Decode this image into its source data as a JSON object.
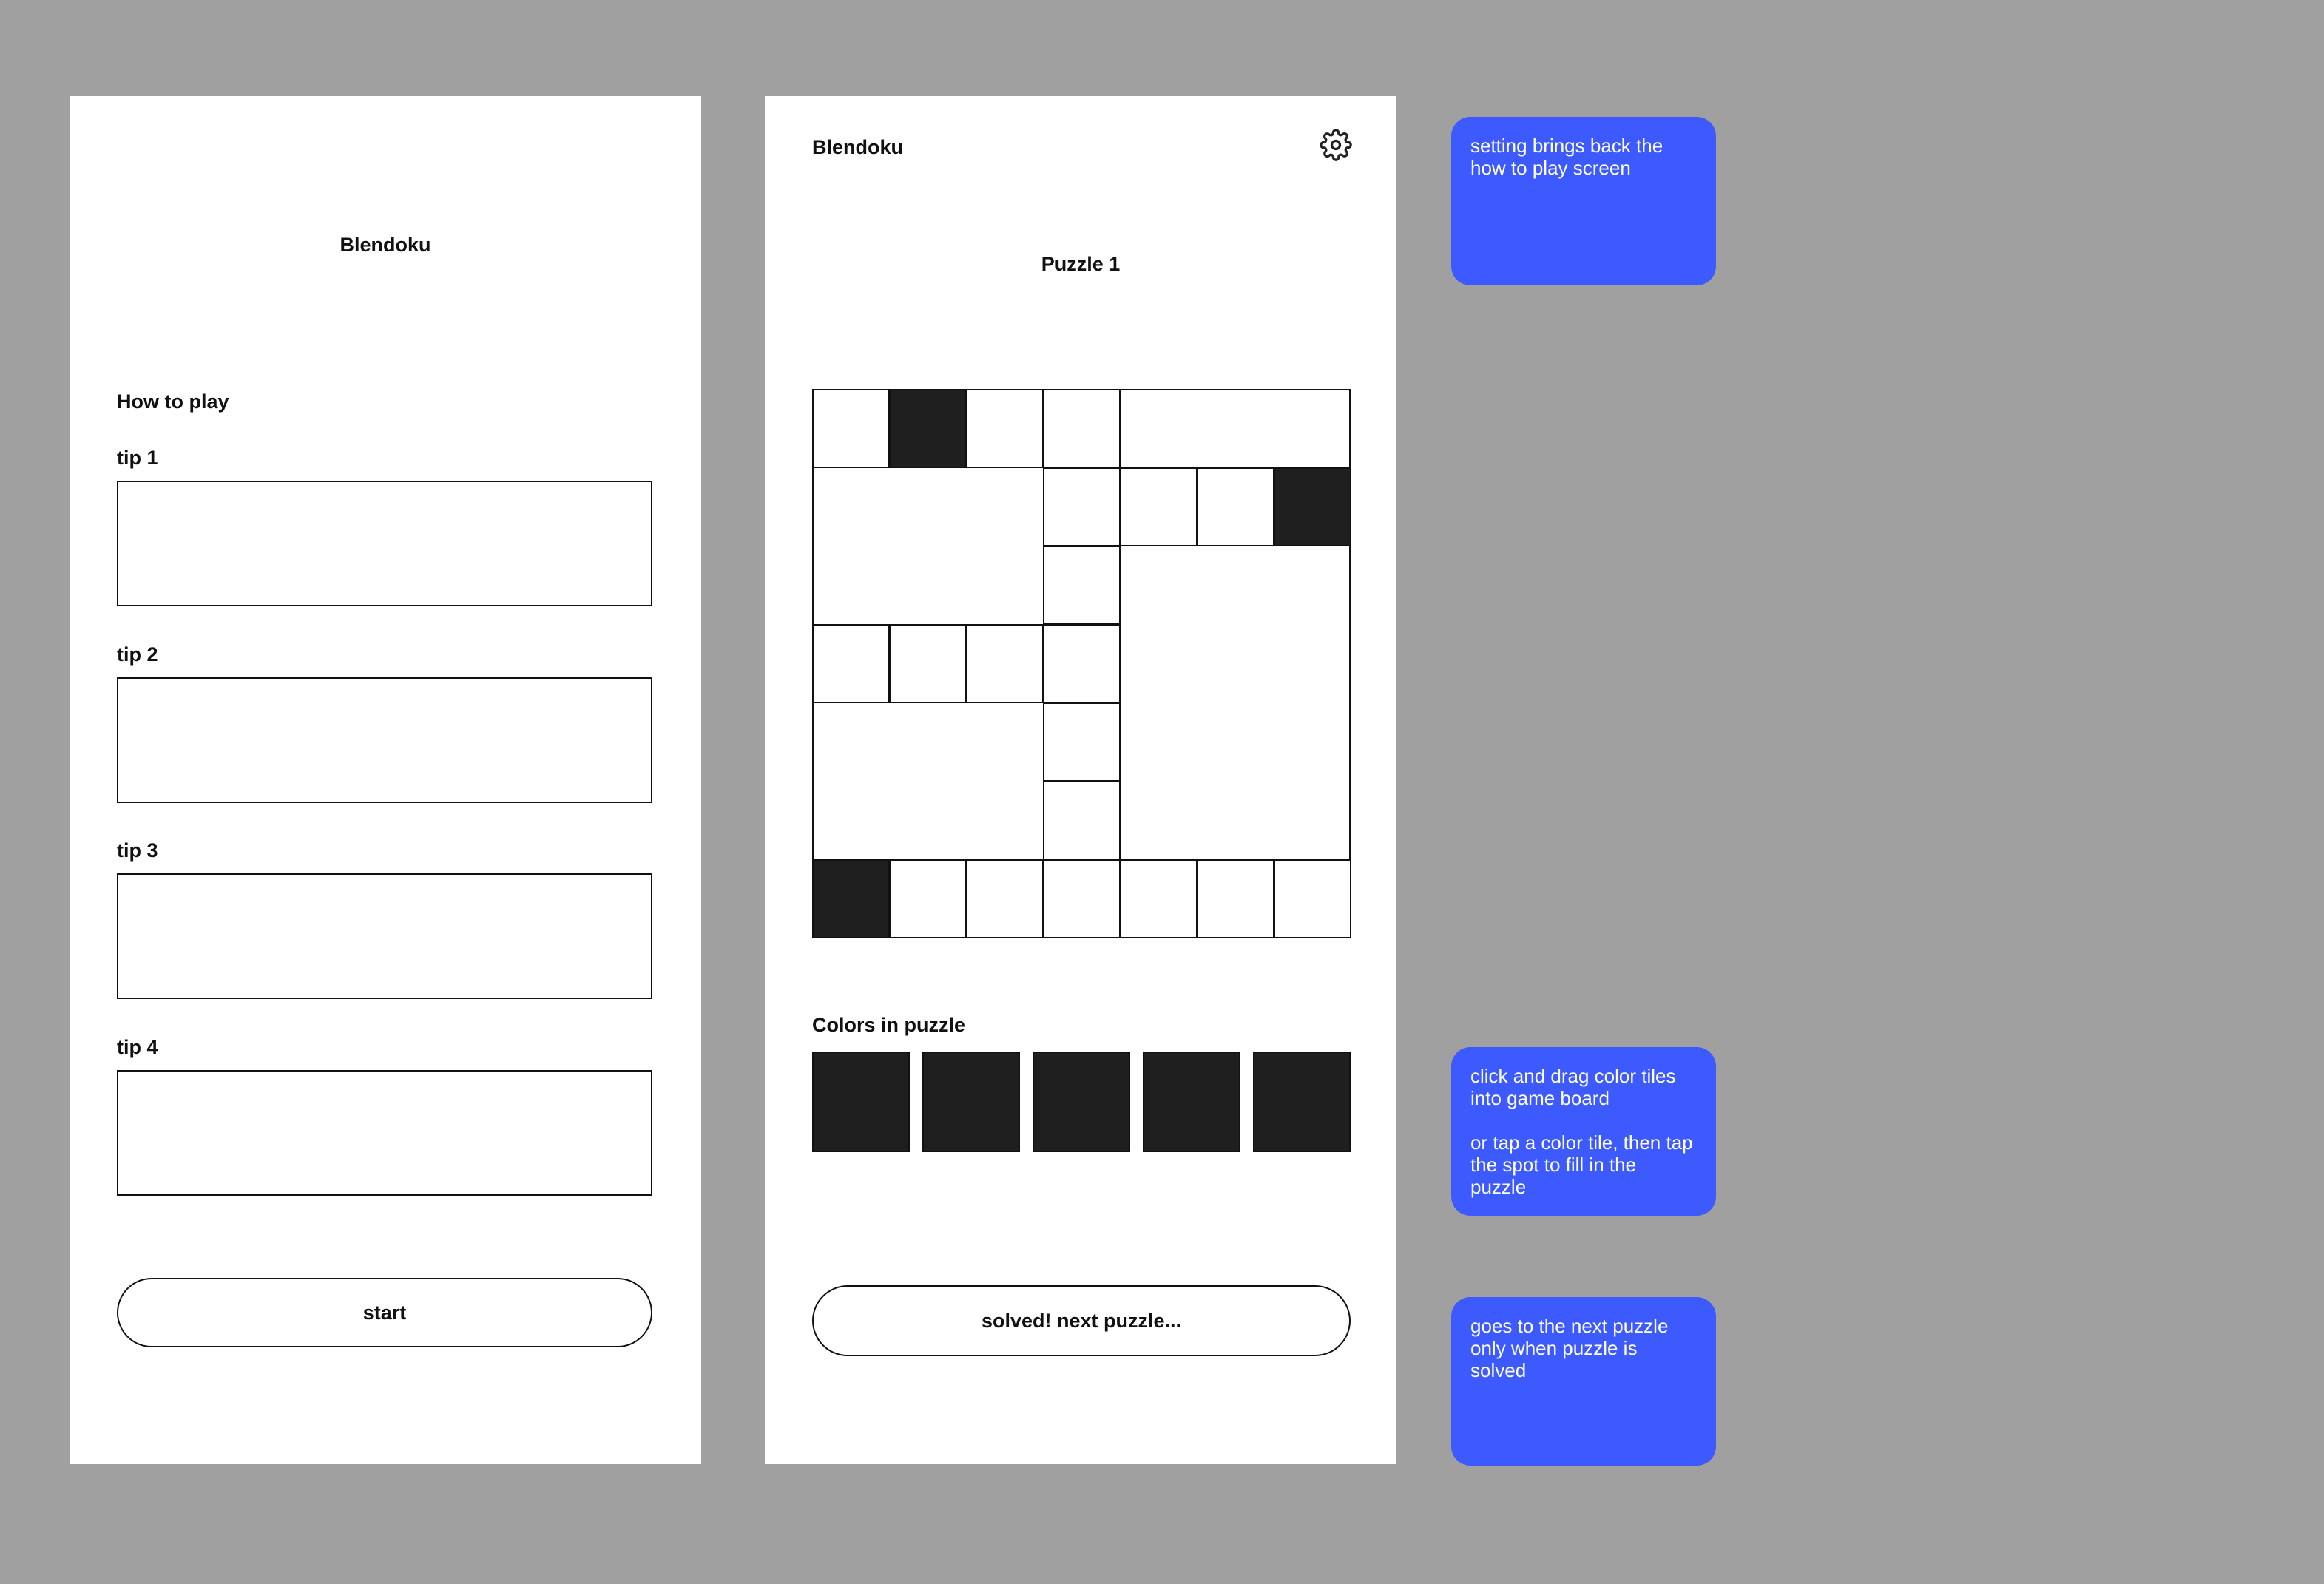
{
  "howto_screen": {
    "app_title": "Blendoku",
    "heading": "How to play",
    "tips": [
      {
        "label": "tip 1"
      },
      {
        "label": "tip 2"
      },
      {
        "label": "tip 3"
      },
      {
        "label": "tip 4"
      }
    ],
    "start_label": "start"
  },
  "puzzle_screen": {
    "app_title": "Blendoku",
    "settings_icon": "gear-icon",
    "puzzle_title": "Puzzle 1",
    "board": {
      "grid_cols": 7,
      "grid_rows": 7,
      "cells": [
        {
          "col": 0,
          "row": 0,
          "filled": false
        },
        {
          "col": 1,
          "row": 0,
          "filled": true
        },
        {
          "col": 2,
          "row": 0,
          "filled": false
        },
        {
          "col": 3,
          "row": 0,
          "filled": false
        },
        {
          "col": 3,
          "row": 1,
          "filled": false
        },
        {
          "col": 4,
          "row": 1,
          "filled": false
        },
        {
          "col": 5,
          "row": 1,
          "filled": false
        },
        {
          "col": 6,
          "row": 1,
          "filled": true
        },
        {
          "col": 3,
          "row": 2,
          "filled": false
        },
        {
          "col": 0,
          "row": 3,
          "filled": false
        },
        {
          "col": 1,
          "row": 3,
          "filled": false
        },
        {
          "col": 2,
          "row": 3,
          "filled": false
        },
        {
          "col": 3,
          "row": 3,
          "filled": false
        },
        {
          "col": 3,
          "row": 4,
          "filled": false
        },
        {
          "col": 3,
          "row": 5,
          "filled": false
        },
        {
          "col": 0,
          "row": 6,
          "filled": true
        },
        {
          "col": 1,
          "row": 6,
          "filled": false
        },
        {
          "col": 2,
          "row": 6,
          "filled": false
        },
        {
          "col": 3,
          "row": 6,
          "filled": false
        },
        {
          "col": 4,
          "row": 6,
          "filled": false
        },
        {
          "col": 5,
          "row": 6,
          "filled": false
        },
        {
          "col": 6,
          "row": 6,
          "filled": false
        }
      ],
      "filled_color": "#1f1f1f",
      "empty_color": "#ffffff"
    },
    "colors_heading": "Colors in puzzle",
    "palette": [
      "#1f1f1f",
      "#1f1f1f",
      "#1f1f1f",
      "#1f1f1f",
      "#1f1f1f"
    ],
    "next_button_label": "solved! next puzzle..."
  },
  "notes": {
    "settings_note": "setting brings back the how to play screen",
    "drag_note_1": "click and drag color tiles into game board",
    "drag_note_2": "or tap a color tile, then tap the spot to fill in the puzzle",
    "next_note": "goes to the next puzzle only when puzzle is solved"
  },
  "colors": {
    "background": "#a0a0a0",
    "screen": "#ffffff",
    "note_accent": "#3d5afe",
    "ink": "#111111"
  }
}
